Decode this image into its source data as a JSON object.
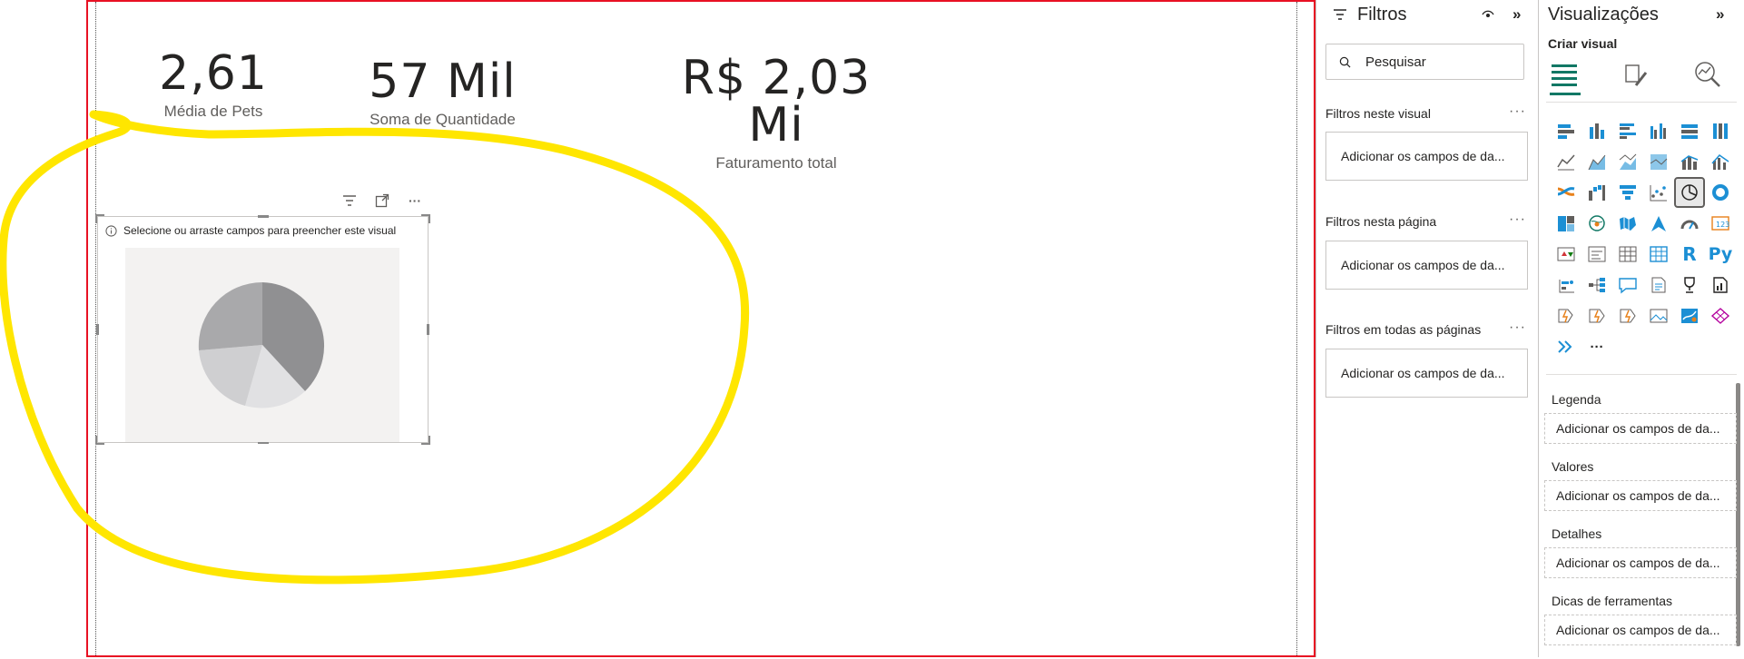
{
  "kpis": [
    {
      "value": "2,61",
      "label": "Média de Pets"
    },
    {
      "value": "57 Mil",
      "label": "Soma de Quantidade"
    },
    {
      "value": "R$ 2,03 Mi",
      "label": "Faturamento total"
    }
  ],
  "pie_visual": {
    "message": "Selecione ou arraste campos para preencher este visual",
    "header_icons": [
      "filter-icon",
      "focus-mode-icon",
      "more-options-icon"
    ],
    "more_label": "···"
  },
  "filters": {
    "title": "Filtros",
    "search_placeholder": "Pesquisar",
    "sections": [
      {
        "title": "Filtros neste visual",
        "drop_label": "Adicionar os campos de da...",
        "more": "···"
      },
      {
        "title": "Filtros nesta página",
        "drop_label": "Adicionar os campos de da...",
        "more": "···"
      },
      {
        "title": "Filtros em todas as páginas",
        "drop_label": "Adicionar os campos de da...",
        "more": "···"
      }
    ]
  },
  "visualizations": {
    "title": "Visualizações",
    "subtitle": "Criar visual",
    "collapse_icon": "chevron-right-double-icon",
    "tabs": [
      "build-visual-icon",
      "format-visual-icon",
      "analytics-icon"
    ],
    "more_label": "···",
    "r_label": "R",
    "py_label": "Py",
    "wells": [
      {
        "title": "Legenda",
        "placeholder": "Adicionar os campos de da..."
      },
      {
        "title": "Valores",
        "placeholder": "Adicionar os campos de da..."
      },
      {
        "title": "Detalhes",
        "placeholder": "Adicionar os campos de da..."
      },
      {
        "title": "Dicas de ferramentas",
        "placeholder": "Adicionar os campos de da..."
      }
    ]
  },
  "colors": {
    "canvas_border": "#e81123",
    "annotation": "#ffe600",
    "accent": "#1c8fd4",
    "teal": "#117865"
  }
}
